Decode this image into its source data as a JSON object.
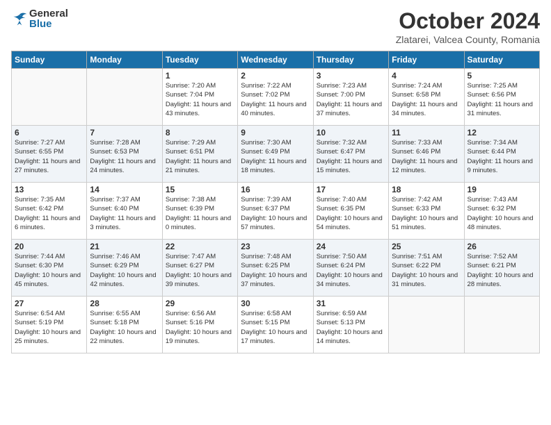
{
  "logo": {
    "general": "General",
    "blue": "Blue"
  },
  "header": {
    "month": "October 2024",
    "location": "Zlatarei, Valcea County, Romania"
  },
  "weekdays": [
    "Sunday",
    "Monday",
    "Tuesday",
    "Wednesday",
    "Thursday",
    "Friday",
    "Saturday"
  ],
  "weeks": [
    [
      {
        "day": "",
        "info": ""
      },
      {
        "day": "",
        "info": ""
      },
      {
        "day": "1",
        "info": "Sunrise: 7:20 AM\nSunset: 7:04 PM\nDaylight: 11 hours and 43 minutes."
      },
      {
        "day": "2",
        "info": "Sunrise: 7:22 AM\nSunset: 7:02 PM\nDaylight: 11 hours and 40 minutes."
      },
      {
        "day": "3",
        "info": "Sunrise: 7:23 AM\nSunset: 7:00 PM\nDaylight: 11 hours and 37 minutes."
      },
      {
        "day": "4",
        "info": "Sunrise: 7:24 AM\nSunset: 6:58 PM\nDaylight: 11 hours and 34 minutes."
      },
      {
        "day": "5",
        "info": "Sunrise: 7:25 AM\nSunset: 6:56 PM\nDaylight: 11 hours and 31 minutes."
      }
    ],
    [
      {
        "day": "6",
        "info": "Sunrise: 7:27 AM\nSunset: 6:55 PM\nDaylight: 11 hours and 27 minutes."
      },
      {
        "day": "7",
        "info": "Sunrise: 7:28 AM\nSunset: 6:53 PM\nDaylight: 11 hours and 24 minutes."
      },
      {
        "day": "8",
        "info": "Sunrise: 7:29 AM\nSunset: 6:51 PM\nDaylight: 11 hours and 21 minutes."
      },
      {
        "day": "9",
        "info": "Sunrise: 7:30 AM\nSunset: 6:49 PM\nDaylight: 11 hours and 18 minutes."
      },
      {
        "day": "10",
        "info": "Sunrise: 7:32 AM\nSunset: 6:47 PM\nDaylight: 11 hours and 15 minutes."
      },
      {
        "day": "11",
        "info": "Sunrise: 7:33 AM\nSunset: 6:46 PM\nDaylight: 11 hours and 12 minutes."
      },
      {
        "day": "12",
        "info": "Sunrise: 7:34 AM\nSunset: 6:44 PM\nDaylight: 11 hours and 9 minutes."
      }
    ],
    [
      {
        "day": "13",
        "info": "Sunrise: 7:35 AM\nSunset: 6:42 PM\nDaylight: 11 hours and 6 minutes."
      },
      {
        "day": "14",
        "info": "Sunrise: 7:37 AM\nSunset: 6:40 PM\nDaylight: 11 hours and 3 minutes."
      },
      {
        "day": "15",
        "info": "Sunrise: 7:38 AM\nSunset: 6:39 PM\nDaylight: 11 hours and 0 minutes."
      },
      {
        "day": "16",
        "info": "Sunrise: 7:39 AM\nSunset: 6:37 PM\nDaylight: 10 hours and 57 minutes."
      },
      {
        "day": "17",
        "info": "Sunrise: 7:40 AM\nSunset: 6:35 PM\nDaylight: 10 hours and 54 minutes."
      },
      {
        "day": "18",
        "info": "Sunrise: 7:42 AM\nSunset: 6:33 PM\nDaylight: 10 hours and 51 minutes."
      },
      {
        "day": "19",
        "info": "Sunrise: 7:43 AM\nSunset: 6:32 PM\nDaylight: 10 hours and 48 minutes."
      }
    ],
    [
      {
        "day": "20",
        "info": "Sunrise: 7:44 AM\nSunset: 6:30 PM\nDaylight: 10 hours and 45 minutes."
      },
      {
        "day": "21",
        "info": "Sunrise: 7:46 AM\nSunset: 6:29 PM\nDaylight: 10 hours and 42 minutes."
      },
      {
        "day": "22",
        "info": "Sunrise: 7:47 AM\nSunset: 6:27 PM\nDaylight: 10 hours and 39 minutes."
      },
      {
        "day": "23",
        "info": "Sunrise: 7:48 AM\nSunset: 6:25 PM\nDaylight: 10 hours and 37 minutes."
      },
      {
        "day": "24",
        "info": "Sunrise: 7:50 AM\nSunset: 6:24 PM\nDaylight: 10 hours and 34 minutes."
      },
      {
        "day": "25",
        "info": "Sunrise: 7:51 AM\nSunset: 6:22 PM\nDaylight: 10 hours and 31 minutes."
      },
      {
        "day": "26",
        "info": "Sunrise: 7:52 AM\nSunset: 6:21 PM\nDaylight: 10 hours and 28 minutes."
      }
    ],
    [
      {
        "day": "27",
        "info": "Sunrise: 6:54 AM\nSunset: 5:19 PM\nDaylight: 10 hours and 25 minutes."
      },
      {
        "day": "28",
        "info": "Sunrise: 6:55 AM\nSunset: 5:18 PM\nDaylight: 10 hours and 22 minutes."
      },
      {
        "day": "29",
        "info": "Sunrise: 6:56 AM\nSunset: 5:16 PM\nDaylight: 10 hours and 19 minutes."
      },
      {
        "day": "30",
        "info": "Sunrise: 6:58 AM\nSunset: 5:15 PM\nDaylight: 10 hours and 17 minutes."
      },
      {
        "day": "31",
        "info": "Sunrise: 6:59 AM\nSunset: 5:13 PM\nDaylight: 10 hours and 14 minutes."
      },
      {
        "day": "",
        "info": ""
      },
      {
        "day": "",
        "info": ""
      }
    ]
  ]
}
